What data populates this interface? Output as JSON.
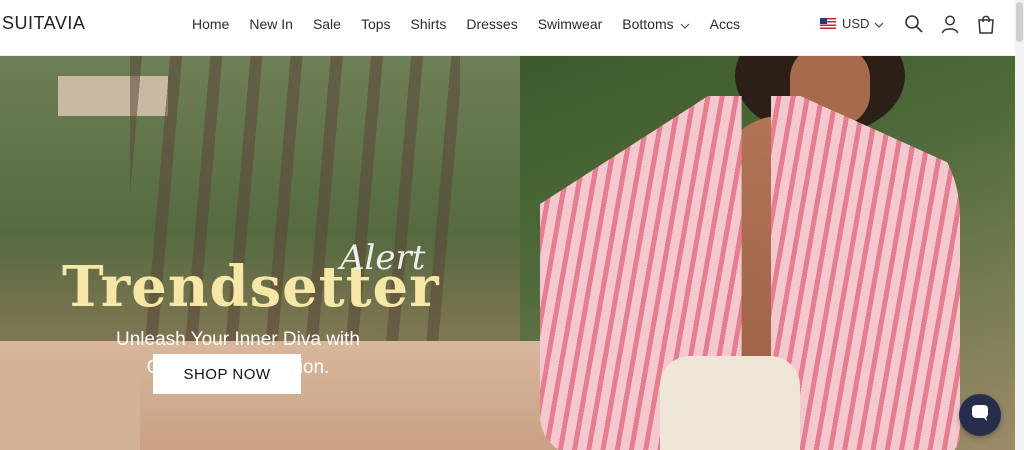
{
  "brand": {
    "logo": "SUITAVIA"
  },
  "nav": {
    "items": [
      {
        "label": "Home"
      },
      {
        "label": "New In"
      },
      {
        "label": "Sale"
      },
      {
        "label": "Tops"
      },
      {
        "label": "Shirts"
      },
      {
        "label": "Dresses"
      },
      {
        "label": "Swimwear"
      },
      {
        "label": "Bottoms",
        "has_dropdown": true
      },
      {
        "label": "Accs"
      }
    ]
  },
  "header_tools": {
    "currency": "USD",
    "flag_icon": "us-flag-icon",
    "icons": [
      "search-icon",
      "account-icon",
      "shopping-bag-icon"
    ]
  },
  "hero": {
    "headline": "Trendsetter",
    "script_overlay": "Alert",
    "tagline_line1": "Unleash Your Inner Diva with",
    "tagline_line2": "Our Latest Collection.",
    "cta": "SHOP NOW",
    "headline_color": "#f6e7a6"
  },
  "chat": {
    "icon": "chat-bubble-icon",
    "color": "#262e4c"
  }
}
